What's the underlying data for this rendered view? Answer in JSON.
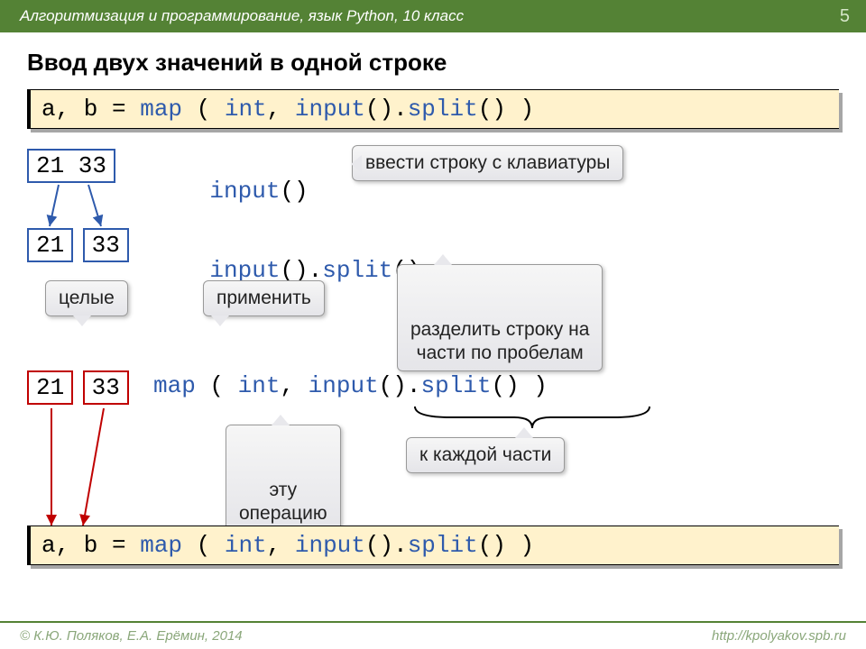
{
  "header": {
    "breadcrumb": "Алгоритмизация и программирование, язык Python, 10 класс",
    "page": "5"
  },
  "title": "Ввод двух значений в одной строке",
  "code1": {
    "pre": "a, b = ",
    "map": "map",
    "mid1": " ( ",
    "int": "int",
    "mid2": ", ",
    "input": "input",
    "par": "().",
    "split": "split",
    "end": "() )"
  },
  "row1": {
    "nums": "21 33",
    "fn": "input",
    "paren": "()"
  },
  "call_input": "ввести строку с клавиатуры",
  "row2": {
    "n1": "21",
    "n2": "33",
    "fn1": "input",
    "dot": "().",
    "fn2": "split",
    "end": "()"
  },
  "call_split": "разделить строку на\nчасти по пробелам",
  "call_apply": "применить",
  "call_whole": "целые",
  "row3": {
    "n1": "21",
    "n2": "33",
    "map": "map",
    "mid1": " ( ",
    "int": "int",
    "mid2": ", ",
    "input": "input",
    "par": "().",
    "split": "split",
    "end": "() )"
  },
  "call_op": "эту\nоперацию",
  "call_each": "к каждой части",
  "code2": {
    "pre": "a, b = ",
    "map": "map",
    "mid1": " ( ",
    "int": "int",
    "mid2": ", ",
    "input": "input",
    "par": "().",
    "split": "split",
    "end": "() )"
  },
  "footer": {
    "left": "© К.Ю. Поляков, Е.А. Ерёмин, 2014",
    "right": "http://kpolyakov.spb.ru"
  }
}
